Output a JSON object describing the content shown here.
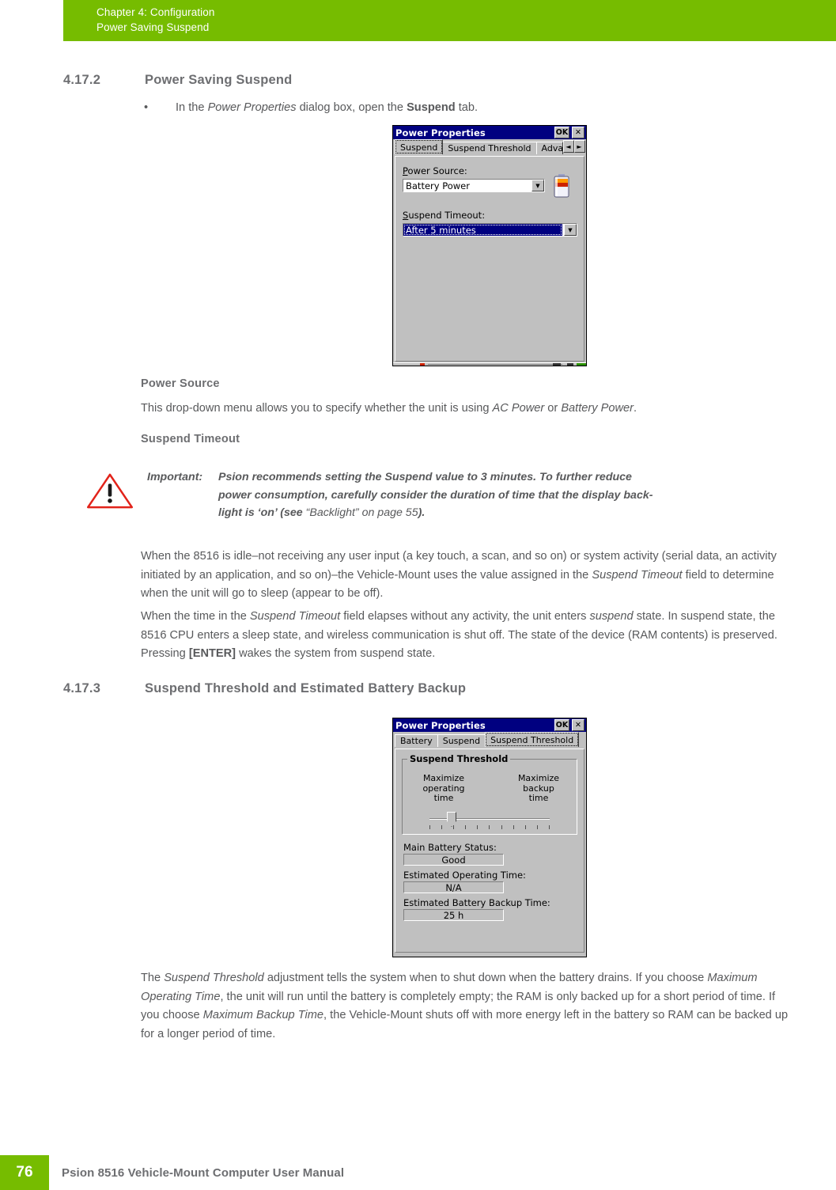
{
  "header": {
    "line1": "Chapter 4:  Configuration",
    "line2": "Power Saving Suspend",
    "bg_color": "#76BC00"
  },
  "sections": {
    "s1": {
      "number": "4.17.2",
      "title": "Power Saving Suspend"
    },
    "s2": {
      "number": "4.17.3",
      "title": "Suspend Threshold and Estimated Battery Backup"
    }
  },
  "bullet": {
    "marker": "•",
    "text_pre": "In the ",
    "text_italic": "Power Properties",
    "text_mid": " dialog box, open the ",
    "text_bold": "Suspend",
    "text_post": " tab."
  },
  "subheads": {
    "power_source": "Power Source",
    "suspend_timeout": "Suspend Timeout"
  },
  "paragraphs": {
    "power_source_desc_pre": "This drop-down menu allows you to specify whether the unit is using ",
    "power_source_desc_i1": "AC Power",
    "power_source_desc_mid": " or ",
    "power_source_desc_i2": "Battery Power",
    "power_source_desc_post": ".",
    "p_idle_a": "When the 8516 is idle–not receiving any user input (a key touch, a scan, and so on) or system activity (serial data, an activity initiated by an application, and so on)–the Vehicle-Mount uses the value assigned in the ",
    "p_idle_i": "Suspend Timeout",
    "p_idle_b": " field to determine when the unit will go to sleep (appear to be off).",
    "p_elapse_a": "When the time in the ",
    "p_elapse_i1": "Suspend Timeout",
    "p_elapse_b": " field elapses without any activity, the unit enters ",
    "p_elapse_i2": "suspend",
    "p_elapse_c": " state. In suspend state, the 8516 CPU enters a sleep state, and wireless communication is shut off. The state of the device (RAM contents) is preserved. Pressing ",
    "p_elapse_key": "[ENTER]",
    "p_elapse_d": " wakes the system from suspend state.",
    "p_threshold_a": "The ",
    "p_threshold_i1": "Suspend Threshold",
    "p_threshold_b": " adjustment tells the system when to shut down when the battery drains. If you choose ",
    "p_threshold_i2": "Maximum Operating Time",
    "p_threshold_c": ", the unit will run until the battery is completely empty; the RAM is only backed up for a short period of time. If you choose ",
    "p_threshold_i3": "Maximum Backup Time",
    "p_threshold_d": ", the Vehicle-Mount shuts off with more energy left in the battery so RAM can be backed up for a longer period of time."
  },
  "important_note": {
    "icon": "warning-triangle-icon",
    "icon_color": "#E2231A",
    "label": "Important:",
    "line1": "Psion recommends setting the Suspend value to 3 minutes. To further reduce",
    "line2": "power consumption, carefully consider the duration of time that the display back-",
    "line3_a": "light is ‘on’ (see ",
    "line3_ref": "“Backlight” on page 55",
    "line3_b": ")."
  },
  "dialog_suspend": {
    "title": "Power Properties",
    "ok_label": "OK",
    "close_label": "✕",
    "tabs": [
      {
        "label": "Suspend",
        "active": true
      },
      {
        "label": "Suspend Threshold",
        "active": false
      },
      {
        "label": "Adva",
        "active": false
      }
    ],
    "nav_prev": "◄",
    "nav_next": "►",
    "power_source_label": "Power Source:",
    "power_source_accel": "P",
    "power_source_value": "Battery Power",
    "suspend_timeout_label": "Suspend Timeout:",
    "suspend_timeout_accel": "S",
    "suspend_timeout_value": "After 5 minutes",
    "dropdown_arrow": "▼",
    "battery_icon": "battery-icon"
  },
  "dialog_threshold": {
    "title": "Power Properties",
    "ok_label": "OK",
    "close_label": "✕",
    "tabs": [
      {
        "label": "Battery",
        "active": false
      },
      {
        "label": "Suspend",
        "active": false
      },
      {
        "label": "Suspend Threshold",
        "active": true
      }
    ],
    "group_title": "Suspend Threshold",
    "slider_left_label": "Maximize\noperating\ntime",
    "slider_left_l1": "Maximize",
    "slider_left_l2": "operating",
    "slider_left_l3": "time",
    "slider_right_l1": "Maximize",
    "slider_right_l2": "backup",
    "slider_right_l3": "time",
    "slider_position_percent": 18,
    "slider_tick_count": 11,
    "fields": [
      {
        "label": "Main Battery Status:",
        "value": "Good"
      },
      {
        "label": "Estimated Operating Time:",
        "value": "N/A"
      },
      {
        "label": "Estimated Battery Backup Time:",
        "value": "25 h"
      }
    ]
  },
  "footer": {
    "page_number": "76",
    "text": "Psion 8516 Vehicle-Mount Computer User Manual",
    "accent_color": "#76BC00"
  }
}
